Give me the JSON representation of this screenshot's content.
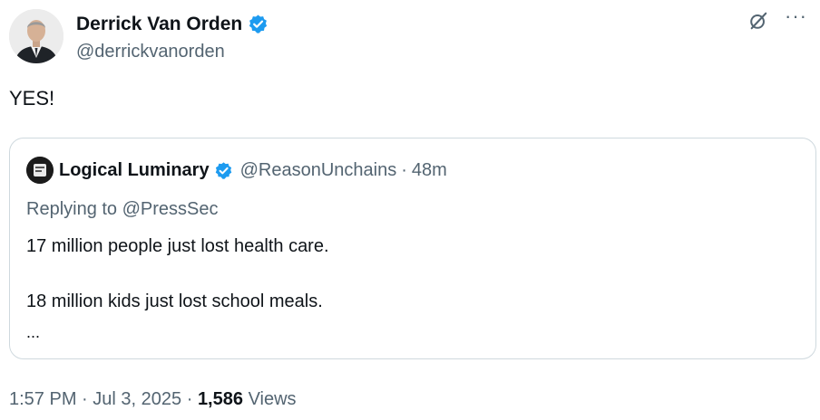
{
  "author": {
    "display_name": "Derrick Van Orden",
    "handle": "@derrickvanorden",
    "avatar_icon": "person-portrait-avatar",
    "verified_icon": "blue-verified-badge-icon"
  },
  "header_actions": {
    "grok_icon": "grok-slash-circle-icon",
    "more_label": "···"
  },
  "post_text": "YES!",
  "quoted_post": {
    "display_name": "Logical Luminary",
    "handle": "@ReasonUnchains",
    "separator": "·",
    "time": "48m",
    "replying_prefix": "Replying to",
    "replying_to": "@PressSec",
    "lines": [
      "17 million people just lost health care.",
      "18 million kids just lost school meals.",
      "..."
    ]
  },
  "footer": {
    "time": "1:57 PM",
    "separator": "·",
    "date": "Jul 3, 2025",
    "views_count": "1,586",
    "views_label": "Views"
  },
  "colors": {
    "verified_blue": "#1d9bf0",
    "secondary_text": "#536471",
    "primary_text": "#0f1419",
    "border": "#cfd9de"
  }
}
